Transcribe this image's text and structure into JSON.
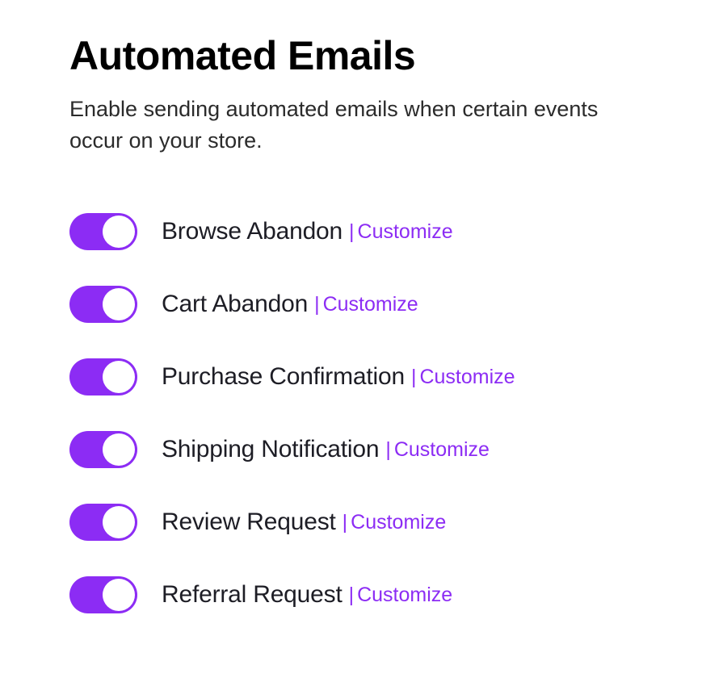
{
  "title": "Automated Emails",
  "subtitle": "Enable sending automated emails when certain events occur on your store.",
  "separator": "|",
  "customize_label": "Customize",
  "colors": {
    "accent": "#8c2cf4"
  },
  "toggles": [
    {
      "label": "Browse Abandon",
      "enabled": true
    },
    {
      "label": "Cart Abandon",
      "enabled": true
    },
    {
      "label": "Purchase Confirmation",
      "enabled": true
    },
    {
      "label": "Shipping Notification",
      "enabled": true
    },
    {
      "label": "Review Request",
      "enabled": true
    },
    {
      "label": "Referral Request",
      "enabled": true
    }
  ]
}
